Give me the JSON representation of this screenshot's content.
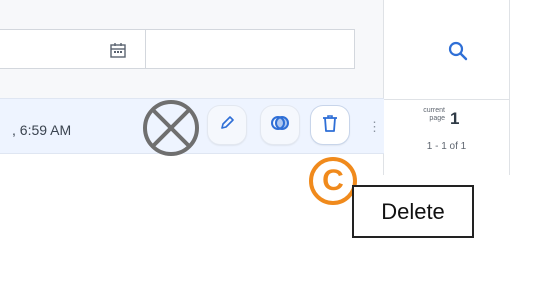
{
  "filter": {
    "date_placeholder": ""
  },
  "row": {
    "time": ", 6:59 AM"
  },
  "actions": {
    "edit": "pencil-icon",
    "merge": "merge-icon",
    "delete": "trash-icon",
    "more": "more-icon"
  },
  "pagination": {
    "current_label_line1": "current",
    "current_label_line2": "page",
    "current_page": "1",
    "range": "1 - 1 of 1"
  },
  "tooltip": {
    "text": "Delete"
  },
  "marker": {
    "letter": "C"
  },
  "colors": {
    "accent": "#2f6fd6",
    "marker": "#f08a1c"
  }
}
